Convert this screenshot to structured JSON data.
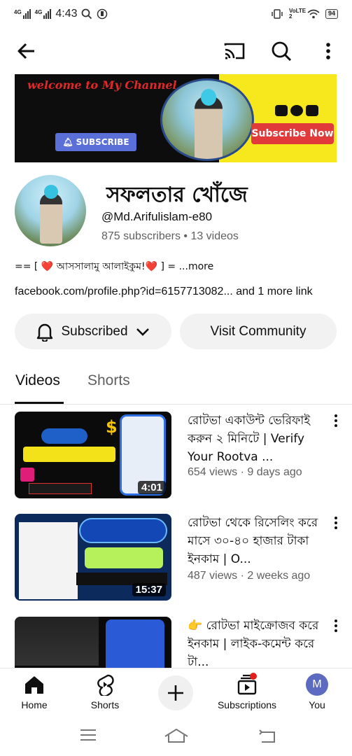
{
  "status_bar": {
    "net1": "4G",
    "net2": "4G",
    "time": "4:43",
    "volte": "VoLTE 2",
    "battery": "94"
  },
  "icons": {
    "back": "arrow-left-icon",
    "cast": "cast-icon",
    "search": "search-icon",
    "menu": "more-vert-icon"
  },
  "banner": {
    "welcome": "welcome to My Channel",
    "subscribe": "SUBSCRIBE",
    "subscribe_now": "Subscribe Now"
  },
  "channel": {
    "name": "সফলতার খোঁজে",
    "handle": "@Md.Arifulislam-e80",
    "stats": "875 subscribers • 13 videos",
    "description_prefix": "== [ ",
    "description_text": " আসসালামু আলাইকুম!",
    "description_suffix": " ] = ...more",
    "heart": "❤️",
    "link": "facebook.com/profile.php?id=6157713082... and 1 more link"
  },
  "actions": {
    "subscribed": "Subscribed",
    "community": "Visit Community"
  },
  "tabs": {
    "videos": "Videos",
    "shorts": "Shorts"
  },
  "videos": [
    {
      "title": "রোটভা একাউন্ট ভেরিফাই করুন ২ মিনিটে | Verify Your Rootva ...",
      "meta": "654 views · 9 days ago",
      "duration": "4:01"
    },
    {
      "title": "রোটভা থেকে রিসেলিং করে মাসে ৩০-৪০ হাজার টাকা ইনকাম | O...",
      "meta": "487 views · 2 weeks ago",
      "duration": "15:37"
    },
    {
      "title": "👉 রোটভা মাইক্রোজব করে ইনকাম | লাইক-কমেন্ট করে টা...",
      "meta": "",
      "duration": ""
    }
  ],
  "bottom_nav": {
    "home": "Home",
    "shorts": "Shorts",
    "subscriptions": "Subscriptions",
    "you": "You",
    "you_initial": "M"
  }
}
